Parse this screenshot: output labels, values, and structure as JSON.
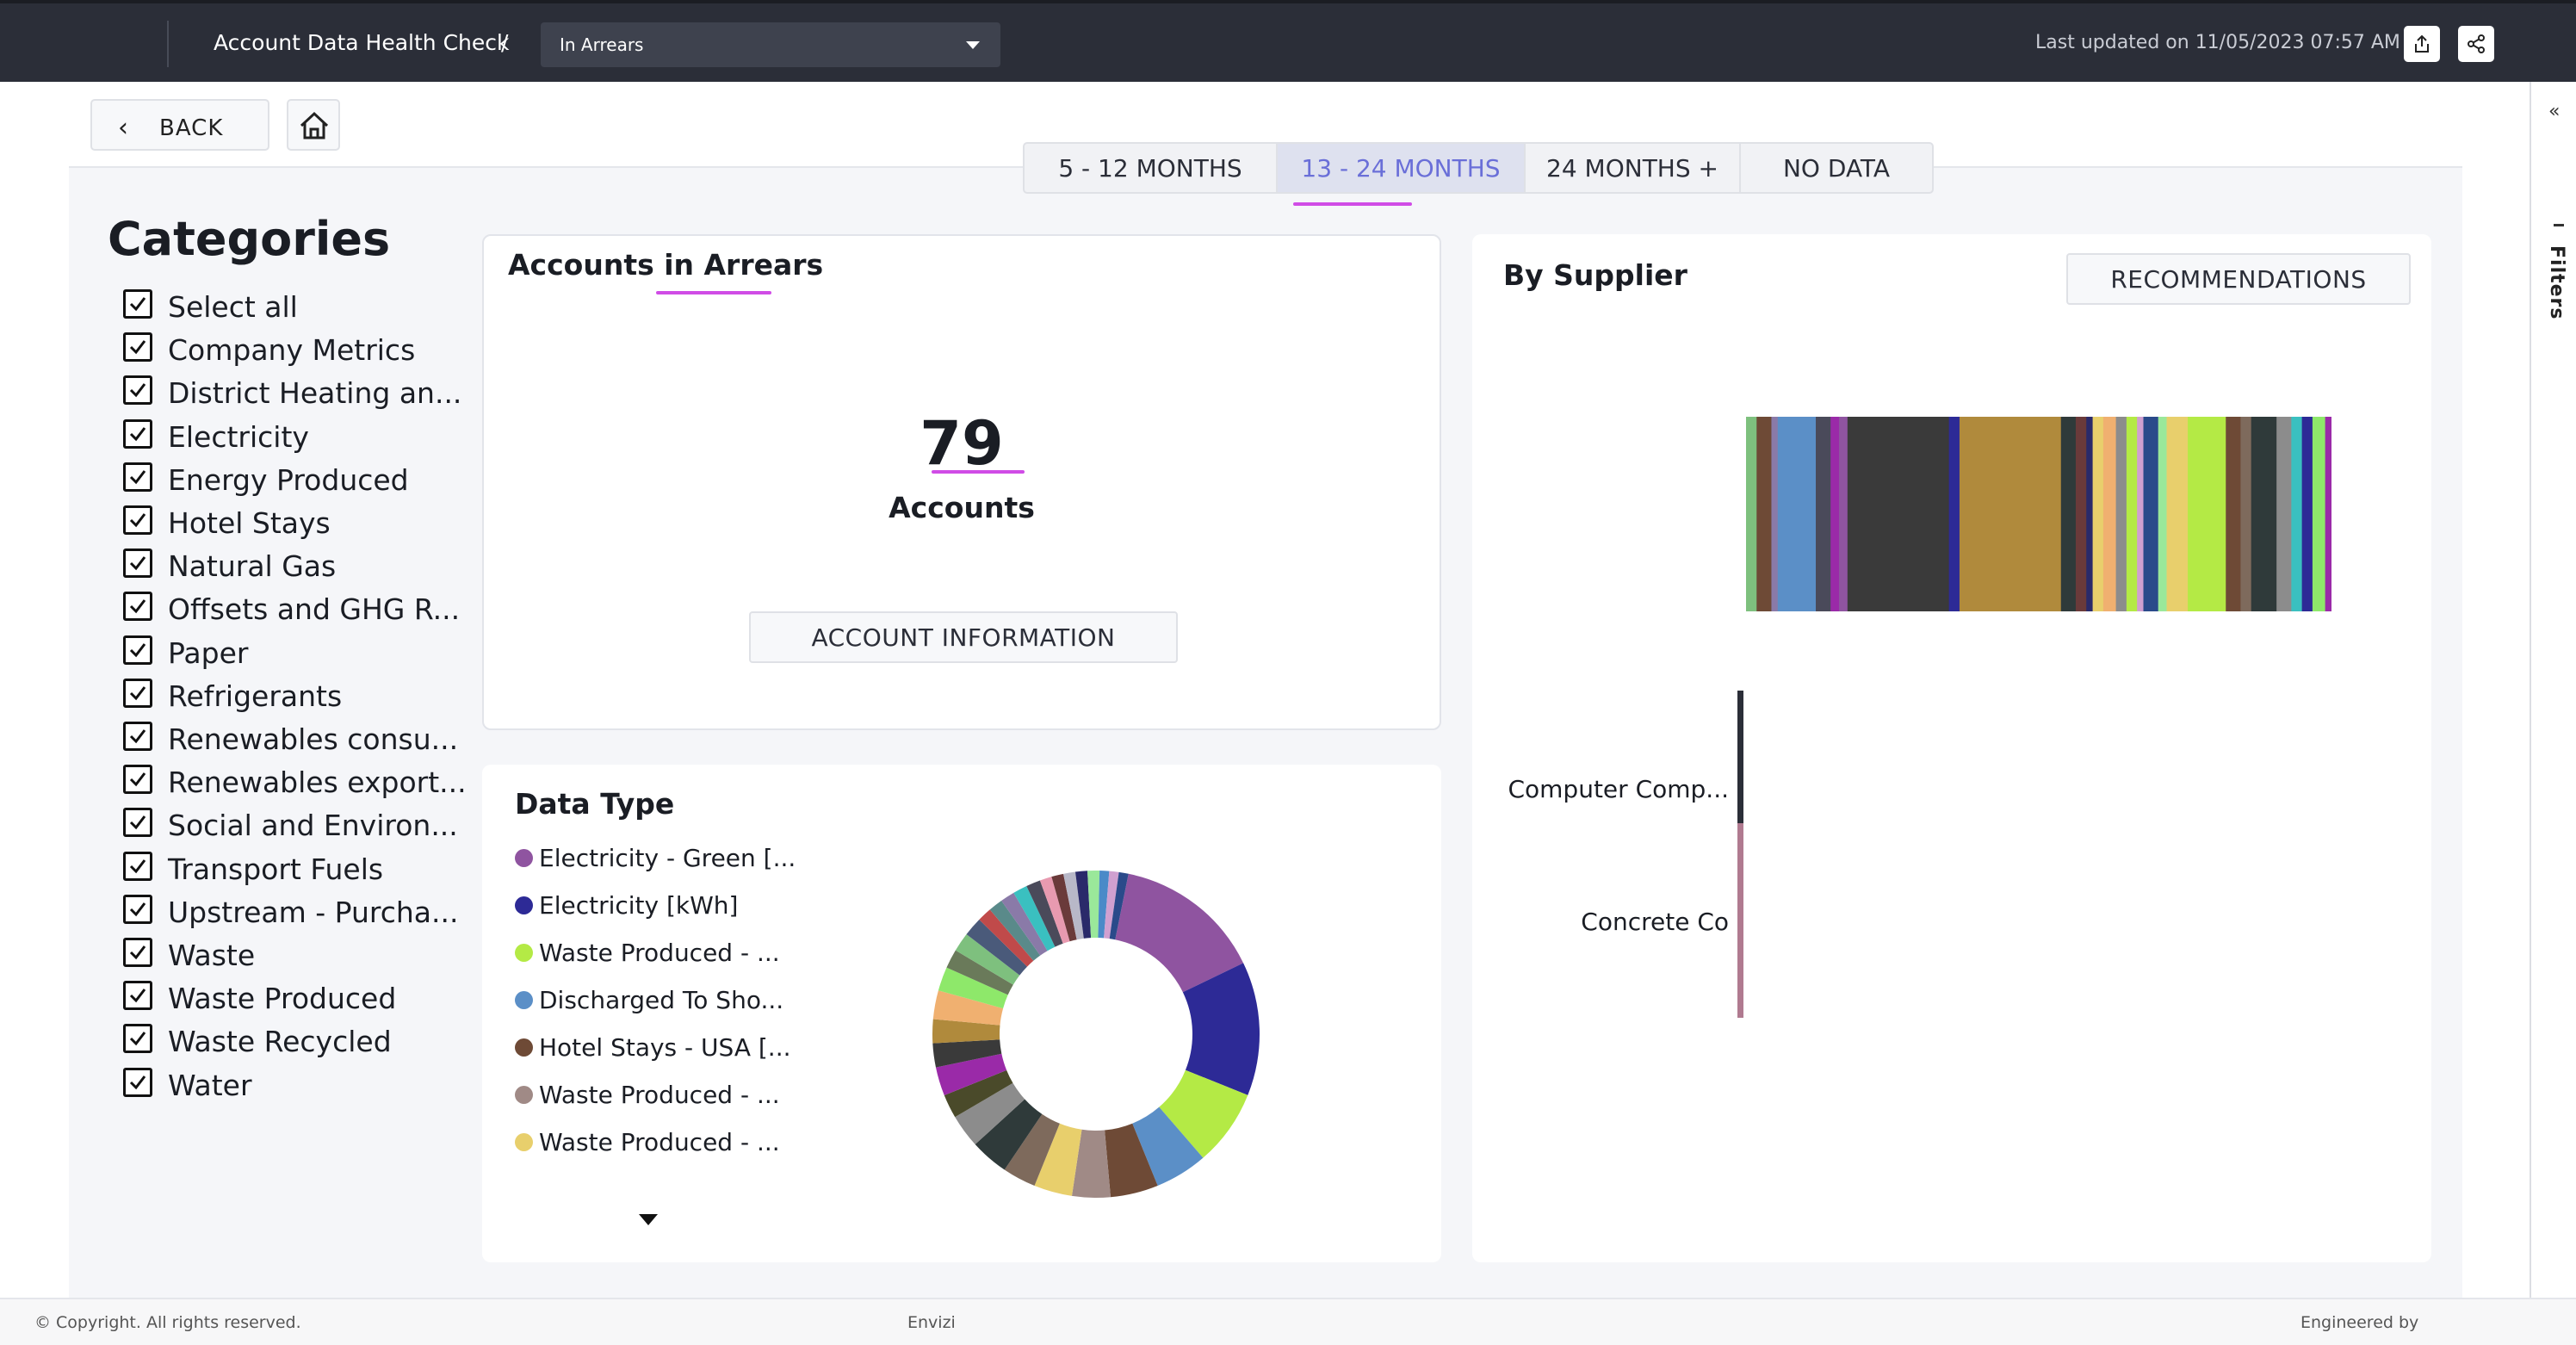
{
  "header": {
    "title": "Account Data Health Check",
    "separator": "/",
    "dropdown_value": "In Arrears",
    "last_updated": "Last updated on 11/05/2023 07:57 AM"
  },
  "nav": {
    "back_label": "BACK"
  },
  "tabs": [
    {
      "label": "5 - 12 MONTHS",
      "active": false
    },
    {
      "label": "13 - 24 MONTHS",
      "active": true
    },
    {
      "label": "24 MONTHS +",
      "active": false
    },
    {
      "label": "NO DATA",
      "active": false
    }
  ],
  "sidebar_right": {
    "collapse": "«",
    "filters_label": "Filters"
  },
  "categories": {
    "title": "Categories",
    "items": [
      "Select all",
      "Company Metrics",
      "District Heating an...",
      "Electricity",
      "Energy Produced",
      "Hotel Stays",
      "Natural Gas",
      "Offsets and GHG R...",
      "Paper",
      "Refrigerants",
      "Renewables consu...",
      "Renewables export...",
      "Social and Environ...",
      "Transport Fuels",
      "Upstream - Purcha...",
      "Waste",
      "Waste Produced",
      "Waste Recycled",
      "Water"
    ]
  },
  "arrears": {
    "title": "Accounts in Arrears",
    "count": "79",
    "count_label": "Accounts",
    "button_label": "ACCOUNT INFORMATION"
  },
  "data_type": {
    "title": "Data Type",
    "legend": [
      {
        "label": "Electricity - Green [...",
        "color": "#8f54a0"
      },
      {
        "label": "Electricity [kWh]",
        "color": "#2d2a96"
      },
      {
        "label": "Waste Produced - ...",
        "color": "#b4ea45"
      },
      {
        "label": "Discharged To Sho...",
        "color": "#5b8fc7"
      },
      {
        "label": "Hotel Stays - USA [...",
        "color": "#6e4a36"
      },
      {
        "label": "Waste Produced - ...",
        "color": "#a08a86"
      },
      {
        "label": "Waste Produced - ...",
        "color": "#e8cf6c"
      }
    ]
  },
  "supplier": {
    "title": "By Supplier",
    "button_label": "RECOMMENDATIONS",
    "rows": [
      {
        "label": "Computer Comp...",
        "color": "#2b2e38"
      },
      {
        "label": "Concrete Co",
        "color": "#b07a90"
      }
    ]
  },
  "footer": {
    "copyright": "© Copyright. All rights reserved.",
    "brand": "Envizi",
    "engineered": "Engineered by"
  },
  "colors": {
    "accent": "#d04ce6",
    "active_tab_text": "#6a6fd8",
    "topbar": "#2b2e38"
  }
}
